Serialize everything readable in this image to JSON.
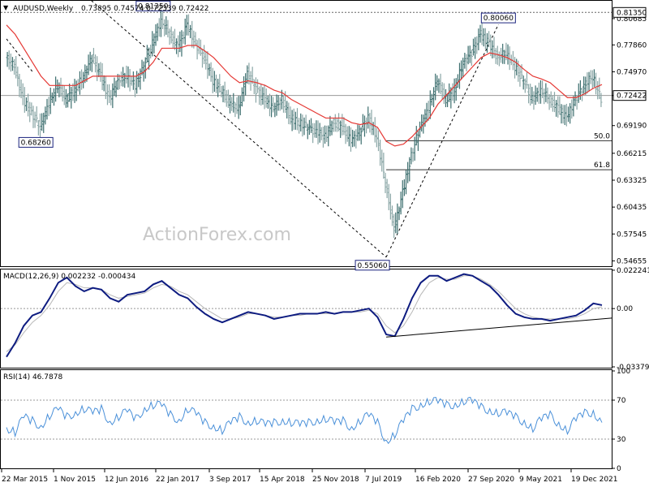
{
  "chart_data": [
    {
      "type": "candlestick-line",
      "symbol_label": "AUDUSD,Weekly",
      "ohlc_label": "0.73895 0.74574 0.72339 0.72422",
      "watermark": "ActionForex.com",
      "ylim": [
        0.5408,
        0.8251
      ],
      "y_ticks": [
        "0.80685",
        "0.77860",
        "0.74970",
        "0.72422",
        "0.69190",
        "0.66215",
        "0.63325",
        "0.60435",
        "0.57545",
        "0.54655"
      ],
      "last_price": "0.72422",
      "top_level": "0.81350",
      "x_dates": [
        "22 Mar 2015",
        "1 Nov 2015",
        "12 Jun 2016",
        "22 Jan 2017",
        "3 Sep 2017",
        "15 Apr 2018",
        "25 Nov 2018",
        "7 Jul 2019",
        "16 Feb 2020",
        "27 Sep 2020",
        "9 May 2021",
        "19 Dec 2021"
      ],
      "annotations": [
        {
          "label": "0.81350",
          "date": "3 Sep 2017",
          "value": 0.8135
        },
        {
          "label": "0.68260",
          "date": "1 Nov 2015",
          "value": 0.6826
        },
        {
          "label": "0.80060",
          "date": "27 Sep 2020",
          "value": 0.8006
        },
        {
          "label": "0.55060",
          "date": "16 Feb 2020",
          "value": 0.5506
        }
      ],
      "fib_levels": [
        {
          "label": "50.0",
          "value": 0.6756
        },
        {
          "label": "61.8",
          "value": 0.6445
        }
      ],
      "series": [
        {
          "name": "",
          "kind": "ohlc-bars",
          "approx_closes": [
            0.765,
            0.755,
            0.72,
            0.705,
            0.69,
            0.715,
            0.735,
            0.72,
            0.73,
            0.745,
            0.765,
            0.745,
            0.72,
            0.74,
            0.745,
            0.735,
            0.755,
            0.78,
            0.805,
            0.79,
            0.775,
            0.8,
            0.78,
            0.765,
            0.74,
            0.73,
            0.715,
            0.71,
            0.75,
            0.73,
            0.72,
            0.71,
            0.72,
            0.7,
            0.695,
            0.69,
            0.685,
            0.68,
            0.695,
            0.69,
            0.675,
            0.685,
            0.7,
            0.68,
            0.63,
            0.58,
            0.62,
            0.66,
            0.69,
            0.71,
            0.74,
            0.72,
            0.73,
            0.76,
            0.77,
            0.79,
            0.78,
            0.765,
            0.77,
            0.755,
            0.74,
            0.72,
            0.73,
            0.72,
            0.71,
            0.7,
            0.72,
            0.735,
            0.745,
            0.72
          ]
        },
        {
          "name": "",
          "kind": "moving-average",
          "values": [
            0.8,
            0.79,
            0.775,
            0.76,
            0.745,
            0.735,
            0.735,
            0.735,
            0.735,
            0.74,
            0.745,
            0.745,
            0.745,
            0.745,
            0.745,
            0.745,
            0.75,
            0.76,
            0.775,
            0.775,
            0.775,
            0.778,
            0.778,
            0.772,
            0.765,
            0.755,
            0.745,
            0.738,
            0.74,
            0.738,
            0.735,
            0.73,
            0.727,
            0.72,
            0.715,
            0.71,
            0.705,
            0.7,
            0.7,
            0.7,
            0.695,
            0.693,
            0.695,
            0.69,
            0.675,
            0.67,
            0.672,
            0.68,
            0.69,
            0.7,
            0.715,
            0.725,
            0.735,
            0.745,
            0.755,
            0.765,
            0.77,
            0.768,
            0.765,
            0.76,
            0.752,
            0.745,
            0.742,
            0.738,
            0.73,
            0.722,
            0.722,
            0.726,
            0.732,
            0.736
          ]
        }
      ],
      "trendlines": [
        {
          "points": [
            [
              0,
              0.785
            ],
            [
              3,
              0.75
            ]
          ]
        },
        {
          "points": [
            [
              9,
              0.833
            ],
            [
              44,
              0.5506
            ]
          ]
        },
        {
          "points": [
            [
              44,
              0.5506
            ],
            [
              57,
              0.8006
            ]
          ]
        }
      ]
    },
    {
      "type": "line",
      "label": "MACD(12,26,9) 0.002232 -0.000434",
      "ylim": [
        -0.0338,
        0.0222
      ],
      "y_ticks": [
        "0.022241",
        "0.00",
        "-0.033799"
      ],
      "series": [
        {
          "name": "",
          "values": [
            -0.028,
            -0.02,
            -0.01,
            -0.004,
            -0.002,
            0.006,
            0.015,
            0.018,
            0.013,
            0.01,
            0.012,
            0.011,
            0.006,
            0.004,
            0.008,
            0.009,
            0.01,
            0.014,
            0.016,
            0.012,
            0.008,
            0.006,
            0.001,
            -0.003,
            -0.006,
            -0.008,
            -0.006,
            -0.004,
            -0.002,
            -0.003,
            -0.004,
            -0.006,
            -0.005,
            -0.004,
            -0.003,
            -0.003,
            -0.003,
            -0.002,
            -0.003,
            -0.002,
            -0.002,
            -0.001,
            0.0,
            -0.005,
            -0.015,
            -0.016,
            -0.006,
            0.006,
            0.015,
            0.019,
            0.019,
            0.016,
            0.018,
            0.02,
            0.019,
            0.016,
            0.013,
            0.008,
            0.002,
            -0.003,
            -0.005,
            -0.006,
            -0.006,
            -0.007,
            -0.006,
            -0.005,
            -0.004,
            -0.001,
            0.003,
            0.002
          ]
        },
        {
          "name": "",
          "values": [
            -0.025,
            -0.021,
            -0.014,
            -0.008,
            -0.004,
            0.002,
            0.01,
            0.015,
            0.014,
            0.012,
            0.012,
            0.011,
            0.008,
            0.006,
            0.007,
            0.008,
            0.009,
            0.012,
            0.014,
            0.013,
            0.01,
            0.008,
            0.004,
            0.0,
            -0.003,
            -0.006,
            -0.006,
            -0.005,
            -0.003,
            -0.003,
            -0.004,
            -0.005,
            -0.005,
            -0.004,
            -0.004,
            -0.003,
            -0.003,
            -0.003,
            -0.003,
            -0.002,
            -0.002,
            -0.002,
            -0.001,
            -0.003,
            -0.01,
            -0.014,
            -0.01,
            -0.002,
            0.008,
            0.015,
            0.018,
            0.017,
            0.017,
            0.019,
            0.019,
            0.017,
            0.014,
            0.01,
            0.005,
            0.0,
            -0.003,
            -0.005,
            -0.006,
            -0.006,
            -0.006,
            -0.006,
            -0.005,
            -0.003,
            0.0,
            0.001
          ]
        }
      ],
      "trendlines": [
        {
          "points": [
            [
              44,
              -0.0165
            ],
            [
              70,
              -0.0055
            ]
          ]
        }
      ]
    },
    {
      "type": "line",
      "label": "RSI(14) 46.7878",
      "ylim": [
        0,
        100
      ],
      "y_ticks": [
        "100",
        "70",
        "30",
        "0"
      ],
      "levels": [
        70,
        30
      ],
      "series": [
        {
          "name": "",
          "values": [
            42,
            38,
            52,
            48,
            44,
            55,
            60,
            52,
            58,
            62,
            56,
            60,
            48,
            54,
            58,
            50,
            62,
            66,
            64,
            54,
            50,
            62,
            55,
            46,
            44,
            40,
            46,
            52,
            48,
            50,
            44,
            46,
            50,
            48,
            44,
            46,
            50,
            52,
            46,
            48,
            42,
            50,
            54,
            46,
            28,
            36,
            48,
            60,
            66,
            70,
            68,
            64,
            66,
            70,
            68,
            62,
            60,
            58,
            56,
            52,
            48,
            42,
            50,
            54,
            46,
            40,
            50,
            56,
            58,
            47
          ]
        }
      ]
    }
  ],
  "colors": {
    "bars": "#5a8a8a",
    "ma": "#e53935",
    "macd": "#0d1b80",
    "signal": "#b8b8b8",
    "rsi": "#4a90d9",
    "trend": "#000000",
    "label_border": "#1a237e"
  }
}
